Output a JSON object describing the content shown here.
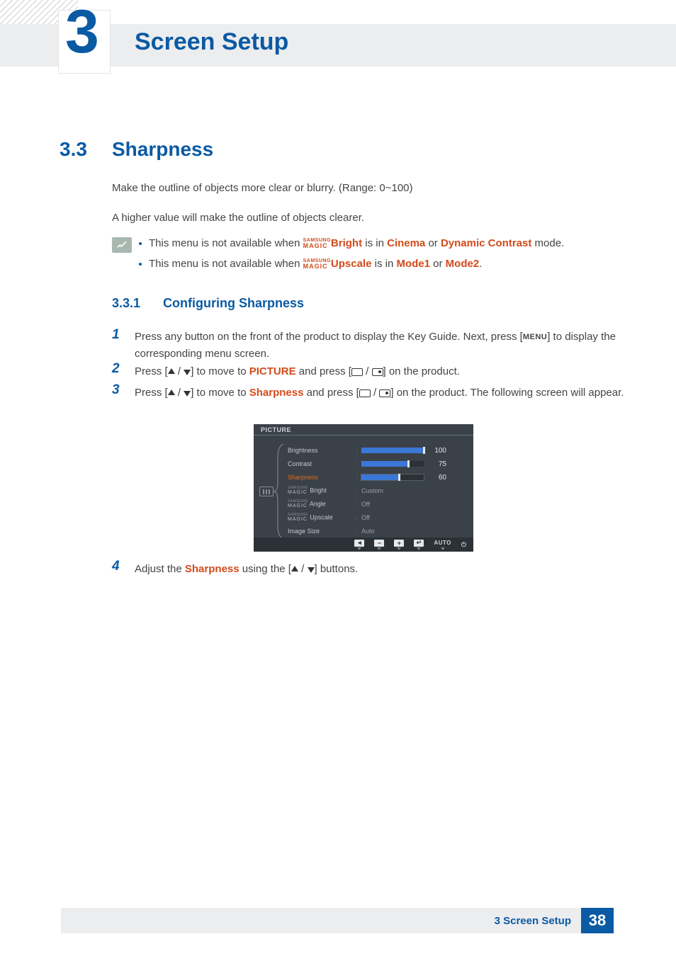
{
  "chapter": {
    "number": "3",
    "title": "Screen Setup"
  },
  "section": {
    "number": "3.3",
    "title": "Sharpness"
  },
  "intro1": "Make the outline of objects more clear or blurry. (Range: 0~100)",
  "intro2": "A higher value will make the outline of objects clearer.",
  "notes": {
    "prefix": "This menu is not available when ",
    "m_top": "SAMSUNG",
    "m_bot": "MAGIC",
    "b1_feat": "Bright",
    "b1_mid": " is in ",
    "b1_a": "Cinema",
    "b1_or": " or ",
    "b1_b": "Dynamic Contrast",
    "b1_end": " mode.",
    "b2_feat": "Upscale",
    "b2_mid": " is in ",
    "b2_a": "Mode1",
    "b2_or": " or ",
    "b2_b": "Mode2",
    "b2_end": "."
  },
  "subsec": {
    "number": "3.3.1",
    "title": "Configuring Sharpness"
  },
  "steps": {
    "s1a": "Press any button on the front of the product to display the Key Guide. Next, press [",
    "s1_menu": "MENU",
    "s1b": "] to display the corresponding menu screen.",
    "s2a": "Press [",
    "s2b": "] to move to ",
    "s2_pic": "PICTURE",
    "s2c": " and press [",
    "s2d": "] on the product.",
    "s3a": "Press [",
    "s3b": "] to move to ",
    "s3_sh": "Sharpness",
    "s3c": " and press [",
    "s3d": "] on the product. The following screen will appear.",
    "s4a": "Adjust the ",
    "s4_sh": "Sharpness",
    "s4b": " using the [",
    "s4c": "] buttons."
  },
  "osd": {
    "title": "PICTURE",
    "rows": [
      {
        "label": "Brightness",
        "value": 100,
        "fill": 100,
        "type": "slider"
      },
      {
        "label": "Contrast",
        "value": 75,
        "fill": 75,
        "type": "slider"
      },
      {
        "label": "Sharpness",
        "value": 60,
        "fill": 60,
        "type": "slider",
        "hl": true
      },
      {
        "label_magic": "Bright",
        "text": "Custom",
        "type": "select"
      },
      {
        "label_magic": "Angle",
        "text": "Off",
        "type": "select"
      },
      {
        "label_magic": "Upscale",
        "text": "Off",
        "type": "select"
      },
      {
        "label": "Image Size",
        "text": "Auto",
        "type": "select"
      }
    ],
    "foot": {
      "auto": "AUTO"
    }
  },
  "footer": {
    "label": "3 Screen Setup",
    "page": "38"
  }
}
